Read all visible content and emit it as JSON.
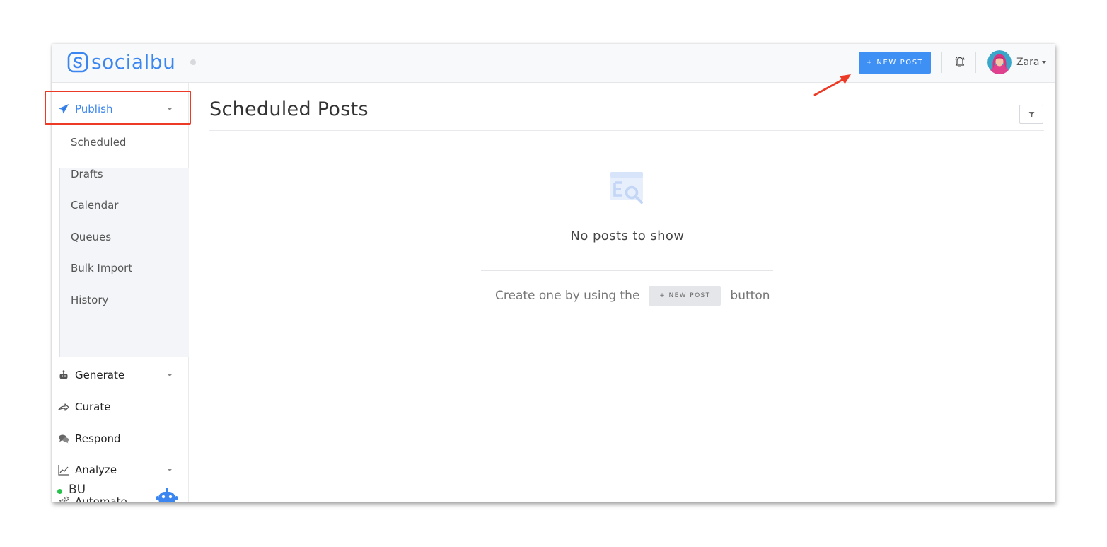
{
  "app": {
    "logo_text": "socialbu"
  },
  "header": {
    "new_post_label": "+ NEW POST",
    "user_name": "Zara"
  },
  "sidebar": {
    "items": [
      {
        "id": "publish",
        "label": "Publish",
        "icon": "paper-plane-icon",
        "expanded": true
      },
      {
        "id": "generate",
        "label": "Generate",
        "icon": "robot-icon",
        "has_caret": true
      },
      {
        "id": "curate",
        "label": "Curate",
        "icon": "share-arrow-icon"
      },
      {
        "id": "respond",
        "label": "Respond",
        "icon": "chat-bubbles-icon"
      },
      {
        "id": "analyze",
        "label": "Analyze",
        "icon": "line-chart-icon",
        "has_caret": true
      },
      {
        "id": "automate",
        "label": "Automate",
        "icon": "gears-icon"
      }
    ],
    "publish_subitems": [
      "Scheduled",
      "Drafts",
      "Calendar",
      "Queues",
      "Bulk Import",
      "History"
    ],
    "workspace_label": "BU"
  },
  "main": {
    "title": "Scheduled Posts",
    "empty_title": "No posts to show",
    "empty_hint_before": "Create one by using the",
    "empty_hint_button": "+ NEW POST",
    "empty_hint_after": "button"
  },
  "colors": {
    "accent": "#3b86f0",
    "new_post_button": "#3e90f5",
    "annotation_red": "#ec3a27",
    "status_green": "#27c24c"
  }
}
